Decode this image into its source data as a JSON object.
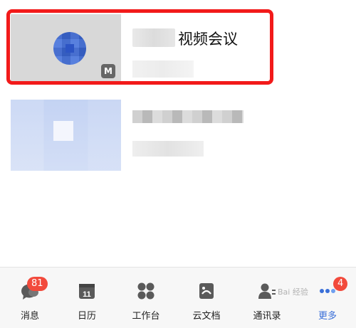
{
  "meetings": [
    {
      "title_suffix": "视频会议",
      "app_badge": "M"
    }
  ],
  "tabbar": {
    "tabs": [
      {
        "label": "消息",
        "badge": "81"
      },
      {
        "label": "日历",
        "date": "11"
      },
      {
        "label": "工作台"
      },
      {
        "label": "云文档"
      },
      {
        "label": "通讯录"
      },
      {
        "label": "更多",
        "badge": "4"
      }
    ]
  },
  "colors": {
    "highlight": "#f21a1a",
    "accent": "#3a6fd8",
    "badge": "#f24a3c"
  },
  "watermark": "Bai 经验"
}
